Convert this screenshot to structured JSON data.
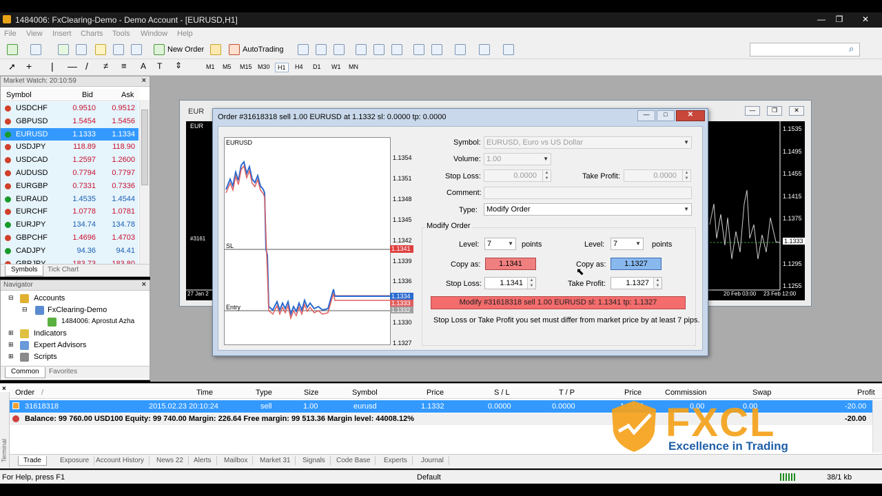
{
  "window": {
    "title": "1484006: FxClearing-Demo - Demo Account - [EURUSD,H1]",
    "min": "—",
    "max": "❐",
    "close": "✕"
  },
  "menu": [
    "File",
    "View",
    "Insert",
    "Charts",
    "Tools",
    "Window",
    "Help"
  ],
  "toolbar": {
    "new_order": "New Order",
    "autotrading": "AutoTrading"
  },
  "timeframes": [
    "M1",
    "M5",
    "M15",
    "M30",
    "H1",
    "H4",
    "D1",
    "W1",
    "MN"
  ],
  "timeframe_selected": "H1",
  "market_watch": {
    "header": "Market Watch: 20:10:59",
    "columns": {
      "symbol": "Symbol",
      "bid": "Bid",
      "ask": "Ask"
    },
    "rows": [
      {
        "symbol": "USDCHF",
        "bid": "0.9510",
        "ask": "0.9512",
        "dir": "dn"
      },
      {
        "symbol": "GBPUSD",
        "bid": "1.5454",
        "ask": "1.5456",
        "dir": "dn"
      },
      {
        "symbol": "EURUSD",
        "bid": "1.1333",
        "ask": "1.1334",
        "dir": "up"
      },
      {
        "symbol": "USDJPY",
        "bid": "118.89",
        "ask": "118.90",
        "dir": "dn"
      },
      {
        "symbol": "USDCAD",
        "bid": "1.2597",
        "ask": "1.2600",
        "dir": "dn"
      },
      {
        "symbol": "AUDUSD",
        "bid": "0.7794",
        "ask": "0.7797",
        "dir": "dn"
      },
      {
        "symbol": "EURGBP",
        "bid": "0.7331",
        "ask": "0.7336",
        "dir": "dn"
      },
      {
        "symbol": "EURAUD",
        "bid": "1.4535",
        "ask": "1.4544",
        "dir": "up"
      },
      {
        "symbol": "EURCHF",
        "bid": "1.0778",
        "ask": "1.0781",
        "dir": "dn"
      },
      {
        "symbol": "EURJPY",
        "bid": "134.74",
        "ask": "134.78",
        "dir": "up"
      },
      {
        "symbol": "GBPCHF",
        "bid": "1.4696",
        "ask": "1.4703",
        "dir": "dn"
      },
      {
        "symbol": "CADJPY",
        "bid": "94.36",
        "ask": "94.41",
        "dir": "up"
      },
      {
        "symbol": "GBPJPY",
        "bid": "183.73",
        "ask": "183.80",
        "dir": "dn"
      }
    ],
    "tabs": [
      "Symbols",
      "Tick Chart"
    ]
  },
  "navigator": {
    "header": "Navigator",
    "accounts": "Accounts",
    "server": "FxClearing-Demo",
    "account": "1484006: Aprostut Azha",
    "indicators": "Indicators",
    "experts": "Expert Advisors",
    "scripts": "Scripts",
    "tabs": [
      "Common",
      "Favorites"
    ]
  },
  "chart": {
    "tab_left": "EUR",
    "label": "EUR",
    "marker": "#3161",
    "prices": [
      "1.1535",
      "1.1495",
      "1.1455",
      "1.1415",
      "1.1375",
      "1.1333",
      "1.1295",
      "1.1255"
    ],
    "dates": [
      "27 Jan 2",
      "20 Feb 03:00",
      "23 Feb 12:00"
    ]
  },
  "order": {
    "title": "Order #31618318 sell 1.00 EURUSD at 1.1332 sl: 0.0000 tp: 0.0000",
    "mini_symbol": "EURUSD",
    "mini_prices": [
      "1.1354",
      "1.1351",
      "1.1348",
      "1.1345",
      "1.1342",
      "1.1339",
      "1.1336",
      "1.1333",
      "1.1330",
      "1.1327"
    ],
    "mini_tags": {
      "sl": "1.1341",
      "ask": "1.1334",
      "bid": "1.1333",
      "entry": "1.1332"
    },
    "mini_sl_label": "SL",
    "mini_entry_label": "Entry",
    "symbol_label": "Symbol:",
    "symbol_value": "EURUSD, Euro vs US Dollar",
    "volume_label": "Volume:",
    "volume_value": "1.00",
    "sl_label": "Stop Loss:",
    "sl_value": "0.0000",
    "tp_label": "Take Profit:",
    "tp_value": "0.0000",
    "comment_label": "Comment:",
    "comment_value": "",
    "type_label": "Type:",
    "type_value": "Modify Order",
    "modify_header": "Modify Order",
    "level_label": "Level:",
    "level_left": "7",
    "level_right": "7",
    "points": "points",
    "copy_as_label": "Copy as:",
    "copy_left": "1.1341",
    "copy_right": "1.1327",
    "new_sl_label": "Stop Loss:",
    "new_sl_value": "1.1341",
    "new_tp_label": "Take Profit:",
    "new_tp_value": "1.1327",
    "modify_button": "Modify #31618318 sell 1.00 EURUSD sl: 1.1341 tp: 1.1327",
    "hint": "Stop Loss or Take Profit you set must differ from market price by at least 7 pips."
  },
  "terminal": {
    "columns": [
      "Order",
      "/",
      "Time",
      "Type",
      "Size",
      "Symbol",
      "Price",
      "S / L",
      "T / P",
      "Price",
      "Commission",
      "Swap",
      "Profit"
    ],
    "row": {
      "order": "31618318",
      "time": "2015.02.23 20:10:24",
      "type": "sell",
      "size": "1.00",
      "symbol": "eurusd",
      "price": "1.1332",
      "sl": "0.0000",
      "tp": "0.0000",
      "cur": "1.1333",
      "commission": "0.00",
      "swap": "0.00",
      "profit": "-20.00"
    },
    "balance": "Balance: 99 760.00 USD100  Equity: 99 740.00  Margin: 226.64  Free margin: 99 513.36  Margin level: 44008.12%",
    "balance_profit": "-20.00",
    "side_label": "Terminal",
    "tabs": [
      "Trade",
      "Exposure",
      "Account History",
      "News 22",
      "Alerts",
      "Mailbox",
      "Market 31",
      "Signals",
      "Code Base",
      "Experts",
      "Journal"
    ]
  },
  "status": {
    "help": "For Help, press F1",
    "profile": "Default",
    "traffic": "38/1 kb"
  },
  "watermark": {
    "brand": "FXCL",
    "tagline": "Excellence in Trading",
    "colors": {
      "orange": "#f5a21b",
      "blue": "#1f5fa8"
    }
  }
}
